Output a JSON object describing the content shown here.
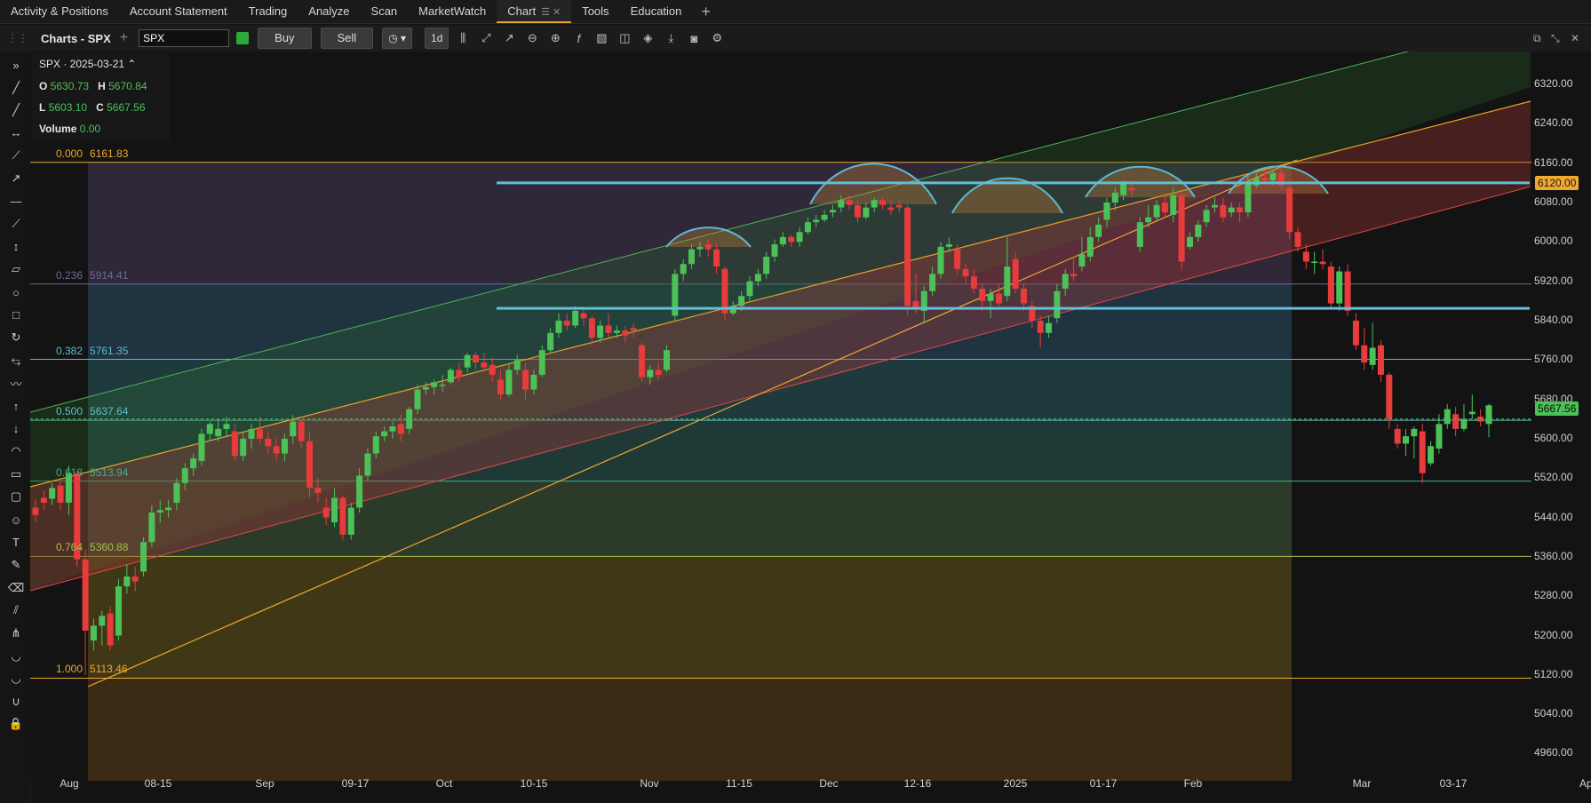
{
  "nav": {
    "tabs": [
      {
        "label": "Activity & Positions"
      },
      {
        "label": "Account Statement"
      },
      {
        "label": "Trading"
      },
      {
        "label": "Analyze"
      },
      {
        "label": "Scan"
      },
      {
        "label": "MarketWatch"
      },
      {
        "label": "Chart",
        "active": true
      },
      {
        "label": "Tools"
      },
      {
        "label": "Education"
      }
    ]
  },
  "toolbar": {
    "title": "Charts - SPX",
    "symbol": "SPX",
    "buy_label": "Buy",
    "sell_label": "Sell",
    "period_label": "1d"
  },
  "legend": {
    "title": "SPX · 2025-03-21",
    "o_label": "O",
    "o": "5630.73",
    "h_label": "H",
    "h": "5670.84",
    "l_label": "L",
    "l": "5603.10",
    "c_label": "C",
    "c": "5667.56",
    "volume_label": "Volume",
    "volume": "0.00"
  },
  "colors": {
    "up": "#4cc158",
    "down": "#e83b3b",
    "fib_top": "#f0a830",
    "channel_line": "#5fb8d0",
    "accent": "#e8a32c"
  },
  "fib_levels": [
    {
      "ratio": "0.000",
      "price": "6161.83"
    },
    {
      "ratio": "0.236",
      "price": "5914.41"
    },
    {
      "ratio": "0.382",
      "price": "5761.35"
    },
    {
      "ratio": "0.500",
      "price": "5637.64"
    },
    {
      "ratio": "0.618",
      "price": "5513.94"
    },
    {
      "ratio": "0.764",
      "price": "5360.88"
    },
    {
      "ratio": "1.000",
      "price": "5113.46"
    }
  ],
  "price_badges": {
    "line": "6120.00",
    "last": "5667.56"
  },
  "chart_data": {
    "type": "candlestick",
    "symbol": "SPX",
    "interval": "1d",
    "y_axis": {
      "ticks": [
        "6320.00",
        "6240.00",
        "6160.00",
        "6080.00",
        "6000.00",
        "5920.00",
        "5840.00",
        "5760.00",
        "5680.00",
        "5600.00",
        "5520.00",
        "5440.00",
        "5360.00",
        "5280.00",
        "5200.00",
        "5120.00",
        "5040.00",
        "4960.00"
      ],
      "range": [
        4950,
        6340
      ]
    },
    "x_axis": {
      "ticks": [
        "Aug",
        "08-15",
        "Sep",
        "09-17",
        "Oct",
        "10-15",
        "Nov",
        "11-15",
        "Dec",
        "12-16",
        "2025",
        "01-17",
        "Feb",
        "Mar",
        "03-17",
        "Ap"
      ]
    },
    "candles": [
      [
        5460,
        5445,
        5475,
        5430
      ],
      [
        5480,
        5470,
        5495,
        5455
      ],
      [
        5478,
        5500,
        5510,
        5465
      ],
      [
        5505,
        5470,
        5515,
        5455
      ],
      [
        5470,
        5530,
        5545,
        5445
      ],
      [
        5530,
        5355,
        5535,
        5340
      ],
      [
        5355,
        5210,
        5375,
        5120
      ],
      [
        5190,
        5220,
        5235,
        5170
      ],
      [
        5220,
        5240,
        5250,
        5180
      ],
      [
        5245,
        5180,
        5260,
        5170
      ],
      [
        5200,
        5300,
        5315,
        5190
      ],
      [
        5300,
        5320,
        5345,
        5285
      ],
      [
        5320,
        5310,
        5340,
        5290
      ],
      [
        5330,
        5390,
        5400,
        5320
      ],
      [
        5390,
        5450,
        5465,
        5380
      ],
      [
        5450,
        5455,
        5475,
        5430
      ],
      [
        5455,
        5460,
        5475,
        5440
      ],
      [
        5470,
        5510,
        5520,
        5455
      ],
      [
        5510,
        5540,
        5550,
        5495
      ],
      [
        5540,
        5560,
        5570,
        5525
      ],
      [
        5555,
        5610,
        5620,
        5545
      ],
      [
        5610,
        5630,
        5635,
        5595
      ],
      [
        5605,
        5620,
        5640,
        5595
      ],
      [
        5620,
        5630,
        5645,
        5605
      ],
      [
        5615,
        5565,
        5630,
        5555
      ],
      [
        5565,
        5600,
        5615,
        5555
      ],
      [
        5600,
        5620,
        5630,
        5580
      ],
      [
        5620,
        5600,
        5645,
        5590
      ],
      [
        5600,
        5585,
        5615,
        5570
      ],
      [
        5585,
        5570,
        5600,
        5555
      ],
      [
        5570,
        5600,
        5610,
        5555
      ],
      [
        5605,
        5635,
        5648,
        5590
      ],
      [
        5635,
        5595,
        5640,
        5580
      ],
      [
        5595,
        5500,
        5615,
        5480
      ],
      [
        5500,
        5490,
        5520,
        5470
      ],
      [
        5460,
        5440,
        5480,
        5425
      ],
      [
        5430,
        5480,
        5500,
        5420
      ],
      [
        5480,
        5405,
        5485,
        5395
      ],
      [
        5405,
        5460,
        5470,
        5395
      ],
      [
        5460,
        5525,
        5540,
        5450
      ],
      [
        5525,
        5570,
        5580,
        5515
      ],
      [
        5570,
        5605,
        5615,
        5560
      ],
      [
        5605,
        5615,
        5625,
        5595
      ],
      [
        5615,
        5625,
        5635,
        5600
      ],
      [
        5630,
        5610,
        5650,
        5595
      ],
      [
        5620,
        5660,
        5665,
        5610
      ],
      [
        5660,
        5700,
        5710,
        5650
      ],
      [
        5700,
        5705,
        5715,
        5690
      ],
      [
        5705,
        5715,
        5720,
        5690
      ],
      [
        5710,
        5710,
        5730,
        5695
      ],
      [
        5715,
        5740,
        5745,
        5710
      ],
      [
        5740,
        5725,
        5755,
        5715
      ],
      [
        5745,
        5770,
        5775,
        5735
      ],
      [
        5770,
        5755,
        5775,
        5740
      ],
      [
        5755,
        5745,
        5775,
        5735
      ],
      [
        5750,
        5730,
        5765,
        5715
      ],
      [
        5720,
        5690,
        5740,
        5680
      ],
      [
        5690,
        5740,
        5750,
        5685
      ],
      [
        5740,
        5760,
        5770,
        5730
      ],
      [
        5740,
        5700,
        5755,
        5680
      ],
      [
        5700,
        5730,
        5740,
        5690
      ],
      [
        5730,
        5780,
        5790,
        5725
      ],
      [
        5780,
        5815,
        5825,
        5775
      ],
      [
        5815,
        5840,
        5855,
        5805
      ],
      [
        5840,
        5830,
        5855,
        5820
      ],
      [
        5830,
        5860,
        5870,
        5825
      ],
      [
        5855,
        5845,
        5865,
        5830
      ],
      [
        5845,
        5805,
        5850,
        5790
      ],
      [
        5805,
        5830,
        5840,
        5795
      ],
      [
        5830,
        5815,
        5855,
        5805
      ],
      [
        5815,
        5820,
        5830,
        5805
      ],
      [
        5820,
        5810,
        5830,
        5795
      ],
      [
        5825,
        5820,
        5835,
        5805
      ],
      [
        5790,
        5725,
        5795,
        5715
      ],
      [
        5725,
        5740,
        5750,
        5710
      ],
      [
        5740,
        5730,
        5755,
        5720
      ],
      [
        5740,
        5780,
        5790,
        5735
      ],
      [
        5850,
        5935,
        5945,
        5840
      ],
      [
        5935,
        5955,
        5965,
        5920
      ],
      [
        5955,
        5985,
        5995,
        5945
      ],
      [
        5985,
        5990,
        6000,
        5970
      ],
      [
        5995,
        5985,
        6005,
        5970
      ],
      [
        5985,
        5950,
        5995,
        5935
      ],
      [
        5945,
        5855,
        5950,
        5840
      ],
      [
        5855,
        5870,
        5880,
        5850
      ],
      [
        5870,
        5890,
        5900,
        5860
      ],
      [
        5890,
        5920,
        5930,
        5880
      ],
      [
        5920,
        5935,
        5945,
        5910
      ],
      [
        5935,
        5970,
        5980,
        5925
      ],
      [
        5970,
        5995,
        6005,
        5960
      ],
      [
        5995,
        6010,
        6020,
        5990
      ],
      [
        6010,
        6000,
        6015,
        5990
      ],
      [
        6000,
        6020,
        6030,
        5990
      ],
      [
        6020,
        6040,
        6050,
        6015
      ],
      [
        6040,
        6045,
        6055,
        6030
      ],
      [
        6045,
        6055,
        6065,
        6040
      ],
      [
        6060,
        6065,
        6075,
        6050
      ],
      [
        6070,
        6085,
        6095,
        6060
      ],
      [
        6085,
        6075,
        6095,
        6065
      ],
      [
        6075,
        6050,
        6085,
        6040
      ],
      [
        6050,
        6070,
        6080,
        6045
      ],
      [
        6070,
        6085,
        6090,
        6060
      ],
      [
        6085,
        6075,
        6090,
        6065
      ],
      [
        6070,
        6065,
        6085,
        6055
      ],
      [
        6075,
        6070,
        6085,
        6060
      ],
      [
        6070,
        5870,
        6075,
        5850
      ],
      [
        5880,
        5865,
        5935,
        5855
      ],
      [
        5860,
        5900,
        5910,
        5835
      ],
      [
        5900,
        5935,
        5950,
        5890
      ],
      [
        5935,
        5990,
        6000,
        5925
      ],
      [
        5990,
        5995,
        6010,
        5980
      ],
      [
        5985,
        5945,
        5995,
        5935
      ],
      [
        5945,
        5930,
        5955,
        5915
      ],
      [
        5930,
        5905,
        5945,
        5895
      ],
      [
        5905,
        5880,
        5915,
        5860
      ],
      [
        5880,
        5895,
        5905,
        5845
      ],
      [
        5895,
        5875,
        5915,
        5870
      ],
      [
        5890,
        5950,
        6010,
        5880
      ],
      [
        5965,
        5905,
        5980,
        5895
      ],
      [
        5905,
        5875,
        5915,
        5860
      ],
      [
        5870,
        5840,
        5880,
        5825
      ],
      [
        5840,
        5815,
        5850,
        5785
      ],
      [
        5815,
        5835,
        5850,
        5805
      ],
      [
        5845,
        5900,
        5915,
        5835
      ],
      [
        5905,
        5935,
        5945,
        5890
      ],
      [
        5935,
        5930,
        5970,
        5920
      ],
      [
        5950,
        5975,
        6010,
        5940
      ],
      [
        5970,
        6010,
        6030,
        5960
      ],
      [
        6010,
        6035,
        6050,
        6000
      ],
      [
        6045,
        6080,
        6090,
        6030
      ],
      [
        6080,
        6100,
        6110,
        6065
      ],
      [
        6095,
        6120,
        6125,
        6085
      ],
      [
        6110,
        6105,
        6125,
        6090
      ],
      [
        5990,
        6040,
        6050,
        5980
      ],
      [
        6040,
        6050,
        6075,
        6030
      ],
      [
        6050,
        6075,
        6085,
        6040
      ],
      [
        6080,
        6060,
        6100,
        6050
      ],
      [
        6055,
        6095,
        6110,
        6040
      ],
      [
        6095,
        5960,
        6100,
        5945
      ],
      [
        5990,
        6010,
        6020,
        5985
      ],
      [
        6010,
        6035,
        6045,
        6000
      ],
      [
        6040,
        6065,
        6075,
        6030
      ],
      [
        6070,
        6075,
        6090,
        6060
      ],
      [
        6075,
        6050,
        6090,
        6040
      ],
      [
        6060,
        6070,
        6080,
        6050
      ],
      [
        6070,
        6060,
        6080,
        6040
      ],
      [
        6060,
        6120,
        6135,
        6050
      ],
      [
        6115,
        6130,
        6140,
        6110
      ],
      [
        6130,
        6125,
        6145,
        6115
      ],
      [
        6125,
        6140,
        6147,
        6115
      ],
      [
        6140,
        6115,
        6150,
        6105
      ],
      [
        6110,
        6020,
        6115,
        6005
      ],
      [
        6020,
        5990,
        6030,
        5980
      ],
      [
        5980,
        5960,
        5995,
        5945
      ],
      [
        5960,
        5960,
        5980,
        5935
      ],
      [
        5960,
        5955,
        5985,
        5945
      ],
      [
        5950,
        5875,
        5960,
        5865
      ],
      [
        5875,
        5940,
        5950,
        5860
      ],
      [
        5940,
        5860,
        5955,
        5850
      ],
      [
        5840,
        5790,
        5855,
        5780
      ],
      [
        5790,
        5755,
        5825,
        5740
      ],
      [
        5750,
        5785,
        5835,
        5740
      ],
      [
        5790,
        5730,
        5800,
        5715
      ],
      [
        5730,
        5640,
        5735,
        5620
      ],
      [
        5620,
        5590,
        5630,
        5580
      ],
      [
        5590,
        5605,
        5620,
        5565
      ],
      [
        5605,
        5620,
        5625,
        5560
      ],
      [
        5615,
        5530,
        5630,
        5510
      ],
      [
        5550,
        5585,
        5595,
        5545
      ],
      [
        5580,
        5630,
        5650,
        5570
      ],
      [
        5630,
        5660,
        5670,
        5620
      ],
      [
        5650,
        5620,
        5665,
        5605
      ],
      [
        5620,
        5640,
        5670,
        5615
      ],
      [
        5650,
        5655,
        5690,
        5640
      ],
      [
        5645,
        5635,
        5660,
        5625
      ],
      [
        5630,
        5668,
        5671,
        5603
      ]
    ],
    "support_lines": [
      "6120.00",
      "5865.00"
    ]
  }
}
